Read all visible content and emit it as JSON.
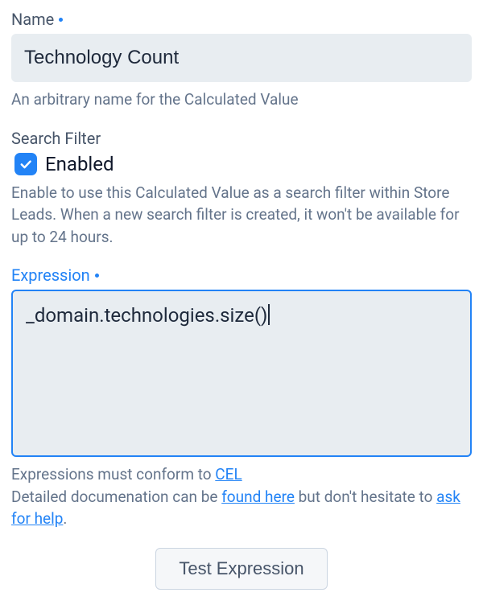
{
  "name_field": {
    "label": "Name",
    "value": "Technology Count",
    "help": "An arbitrary name for the Calculated Value"
  },
  "search_filter": {
    "label": "Search Filter",
    "checkbox_label": "Enabled",
    "checked": true,
    "help": "Enable to use this Calculated Value as a search filter within Store Leads. When a new search filter is created, it won't be available for up to 24 hours."
  },
  "expression": {
    "label": "Expression",
    "value": "_domain.technologies.size()",
    "help_prefix": "Expressions must conform to ",
    "cel_link": "CEL",
    "help2_prefix": "Detailed documenation can be ",
    "found_here_link": "found here",
    "help2_middle": " but don't hesitate to ",
    "ask_link": "ask for help",
    "help2_suffix": "."
  },
  "buttons": {
    "test": "Test Expression"
  }
}
